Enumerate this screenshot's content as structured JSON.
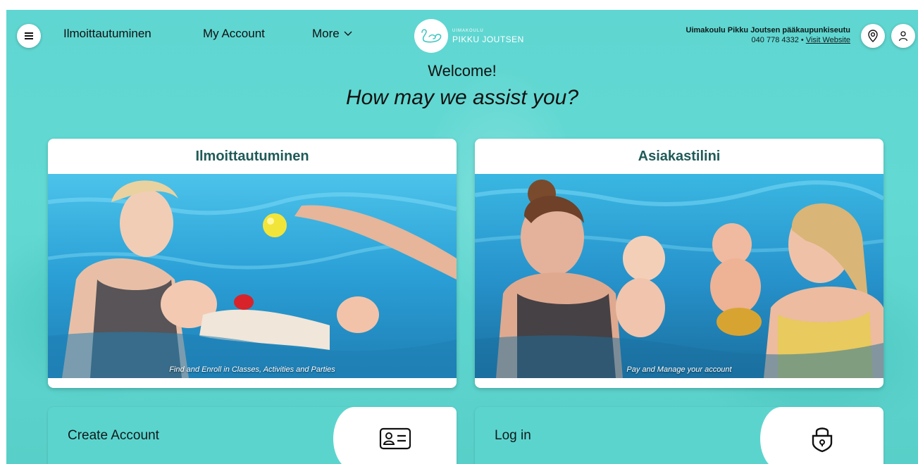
{
  "header": {
    "nav": [
      {
        "label": "Ilmoittautuminen"
      },
      {
        "label": "My Account"
      },
      {
        "label": "More"
      }
    ],
    "logo": {
      "small": "UIMAKOULU",
      "big": "PIKKU JOUTSEN"
    },
    "org": {
      "name": "Uimakoulu Pikku Joutsen pääkaupunkiseutu",
      "phone": "040 778 4332",
      "separator": " • ",
      "link": "Visit Website"
    },
    "icons": [
      "menu-icon",
      "chevron-down-icon",
      "location-pin-icon",
      "user-icon"
    ]
  },
  "welcome": {
    "title": "Welcome!",
    "subtitle": "How may we assist you?"
  },
  "cards": [
    {
      "title": "Ilmoittautuminen",
      "caption": "Find and Enroll in Classes, Activities and Parties"
    },
    {
      "title": "Asiakastilini",
      "caption": "Pay and Manage your account"
    }
  ],
  "actions": [
    {
      "label": "Create Account",
      "icon": "id-card-icon"
    },
    {
      "label": "Log in",
      "icon": "lock-icon"
    }
  ],
  "colors": {
    "accent": "#5fd6d1",
    "title": "#1f5b58",
    "text": "#111111",
    "water": "#2a9fd6"
  }
}
